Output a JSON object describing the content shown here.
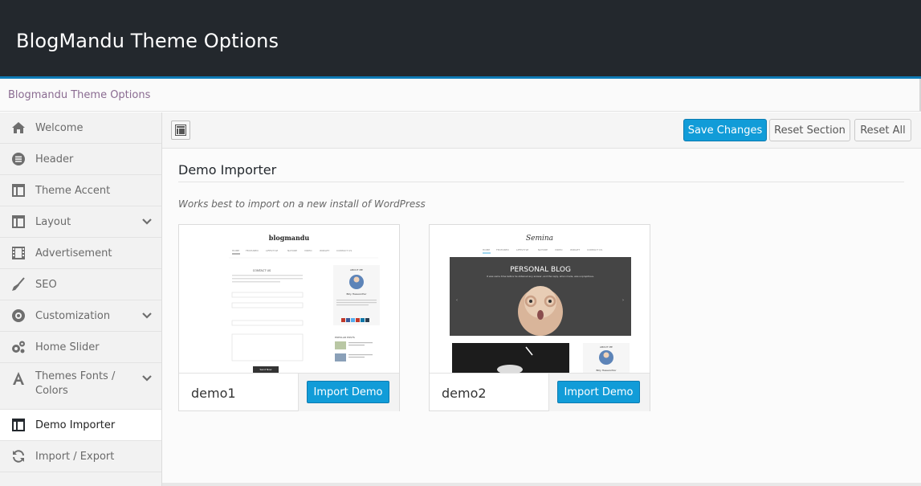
{
  "header": {
    "title": "BlogMandu Theme Options"
  },
  "breadcrumb": {
    "text": "Blogmandu Theme Options"
  },
  "sidebar": {
    "items": [
      {
        "label": "Welcome",
        "icon": "home-icon"
      },
      {
        "label": "Header",
        "icon": "list-circle-icon"
      },
      {
        "label": "Theme Accent",
        "icon": "layout-icon"
      },
      {
        "label": "Layout",
        "icon": "layout-icon",
        "expandable": true
      },
      {
        "label": "Advertisement",
        "icon": "film-icon"
      },
      {
        "label": "SEO",
        "icon": "broom-icon"
      },
      {
        "label": "Customization",
        "icon": "cog-icon",
        "expandable": true
      },
      {
        "label": "Home Slider",
        "icon": "cogs-icon"
      },
      {
        "label": "Themes Fonts / Colors",
        "icon": "font-icon",
        "expandable": true
      },
      {
        "label": "Demo Importer",
        "icon": "layout-icon",
        "active": true
      },
      {
        "label": "Import / Export",
        "icon": "refresh-icon"
      }
    ]
  },
  "toolbar": {
    "save_label": "Save Changes",
    "reset_section_label": "Reset Section",
    "reset_all_label": "Reset All"
  },
  "section": {
    "title": "Demo Importer",
    "description": "Works best to import on a new install of WordPress"
  },
  "demos": [
    {
      "name": "demo1",
      "button_label": "Import Demo",
      "thumb": {
        "logo": "blogmandu",
        "menu": [
          "HOME",
          "FEATURED",
          "LIFESTYLE",
          "NATURE",
          "VIDEO",
          "WIDGET",
          "CONTACT US"
        ],
        "page_heading": "CONTACT US",
        "about_title": "ABOUT ME",
        "author": "Billy Hassandhor",
        "popular_title": "POPULAR POSTS",
        "submit": "Send Now"
      }
    },
    {
      "name": "demo2",
      "button_label": "Import Demo",
      "thumb": {
        "logo": "Semina",
        "menu": [
          "HOME",
          "FEATURED",
          "LIFESTYLE",
          "NATURE",
          "VIDEO",
          "WIDGET",
          "CONTACT US"
        ],
        "hero_title": "PERSONAL BLOG",
        "hero_text": "It was some time before he obtained any answer, and the reply, when made, was unpropitious.",
        "about_title": "ABOUT ME",
        "author": "Billy Hassandhor"
      }
    }
  ],
  "colors": {
    "accent": "#119cd8",
    "topbar": "#23282d",
    "topbar_border": "#0e7bb6"
  }
}
